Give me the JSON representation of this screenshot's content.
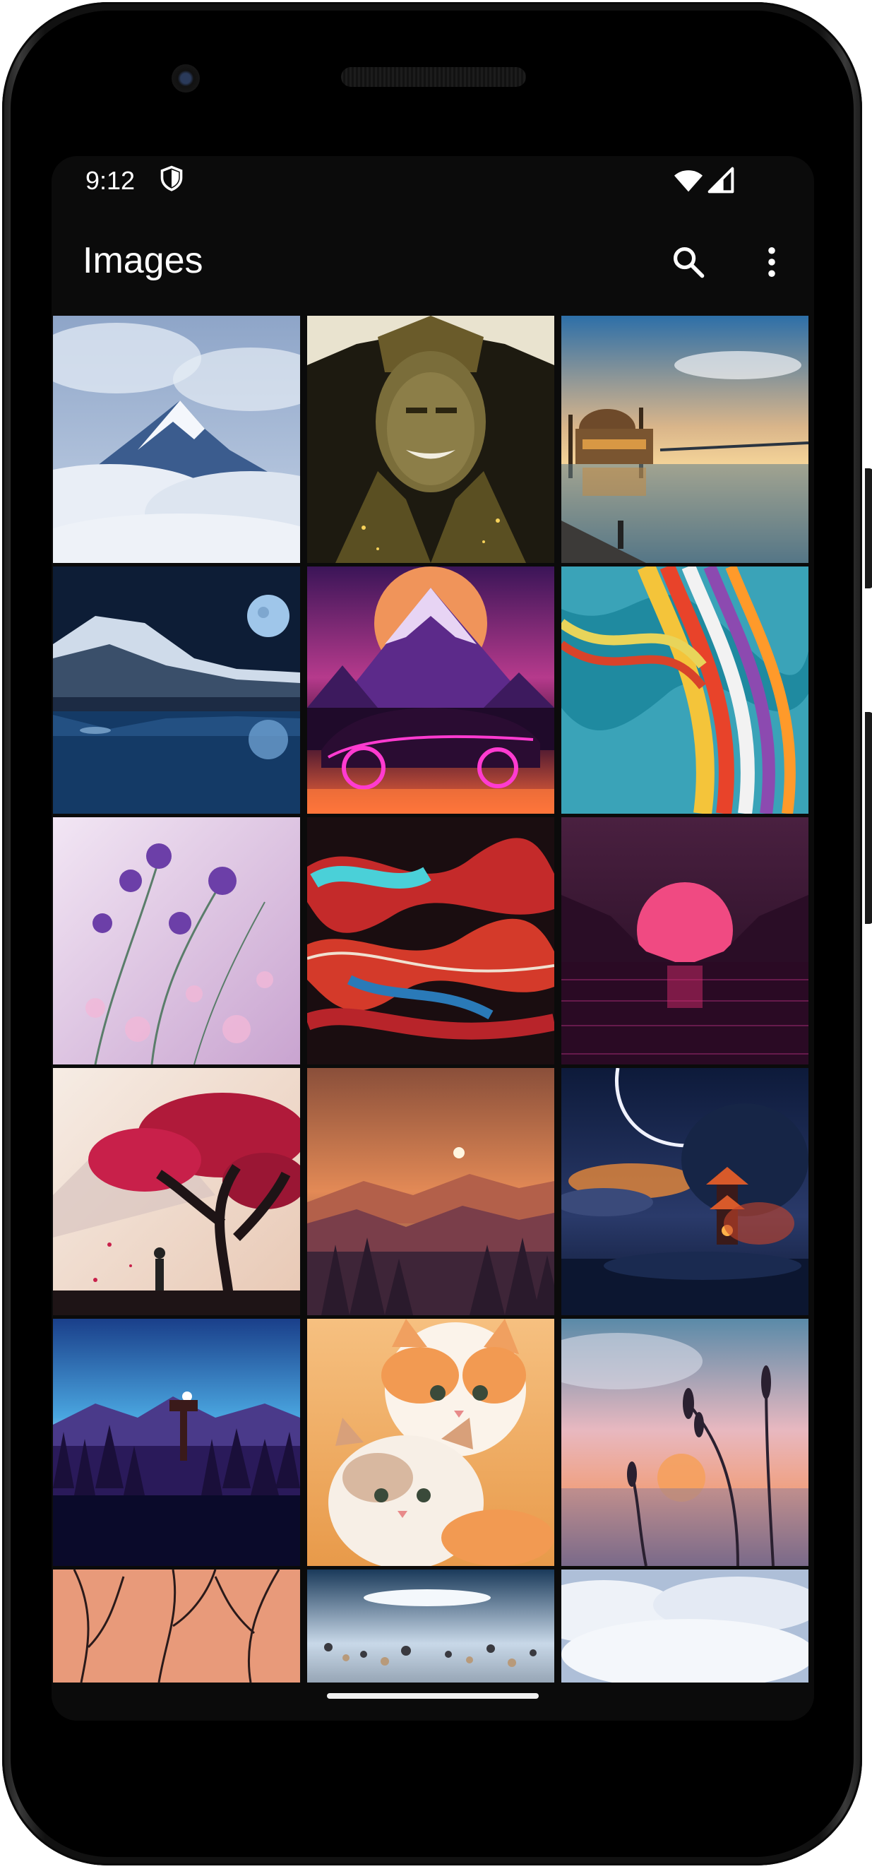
{
  "status_bar": {
    "time": "9:12",
    "icons": [
      "shield-icon",
      "wifi-icon",
      "cell-signal-icon"
    ]
  },
  "app_bar": {
    "title": "Images",
    "actions": [
      "search-icon",
      "more-vert-icon"
    ]
  },
  "gallery": {
    "columns": 3,
    "items": [
      {
        "subject": "snowy-mountain-above-clouds"
      },
      {
        "subject": "armored-warrior-portrait"
      },
      {
        "subject": "mosque-by-water-at-sunset"
      },
      {
        "subject": "moonlit-lake-and-mountains"
      },
      {
        "subject": "synthwave-car-and-mountain"
      },
      {
        "subject": "rainbow-ribbon-waves"
      },
      {
        "subject": "purple-flowers-closeup"
      },
      {
        "subject": "liquid-marble-red-cyan"
      },
      {
        "subject": "pink-sun-over-valley"
      },
      {
        "subject": "red-tree-and-figure"
      },
      {
        "subject": "orange-mountain-sunset-forest"
      },
      {
        "subject": "crescent-moon-pagoda-night"
      },
      {
        "subject": "watchtower-in-purple-forest"
      },
      {
        "subject": "two-kittens"
      },
      {
        "subject": "grass-silhouette-sunset"
      },
      {
        "subject": "bare-branches-orange-sky"
      },
      {
        "subject": "pebble-beach-waves"
      },
      {
        "subject": "clouds-from-above"
      }
    ]
  },
  "colors": {
    "background": "#0b0b0b",
    "text": "#ffffff"
  }
}
